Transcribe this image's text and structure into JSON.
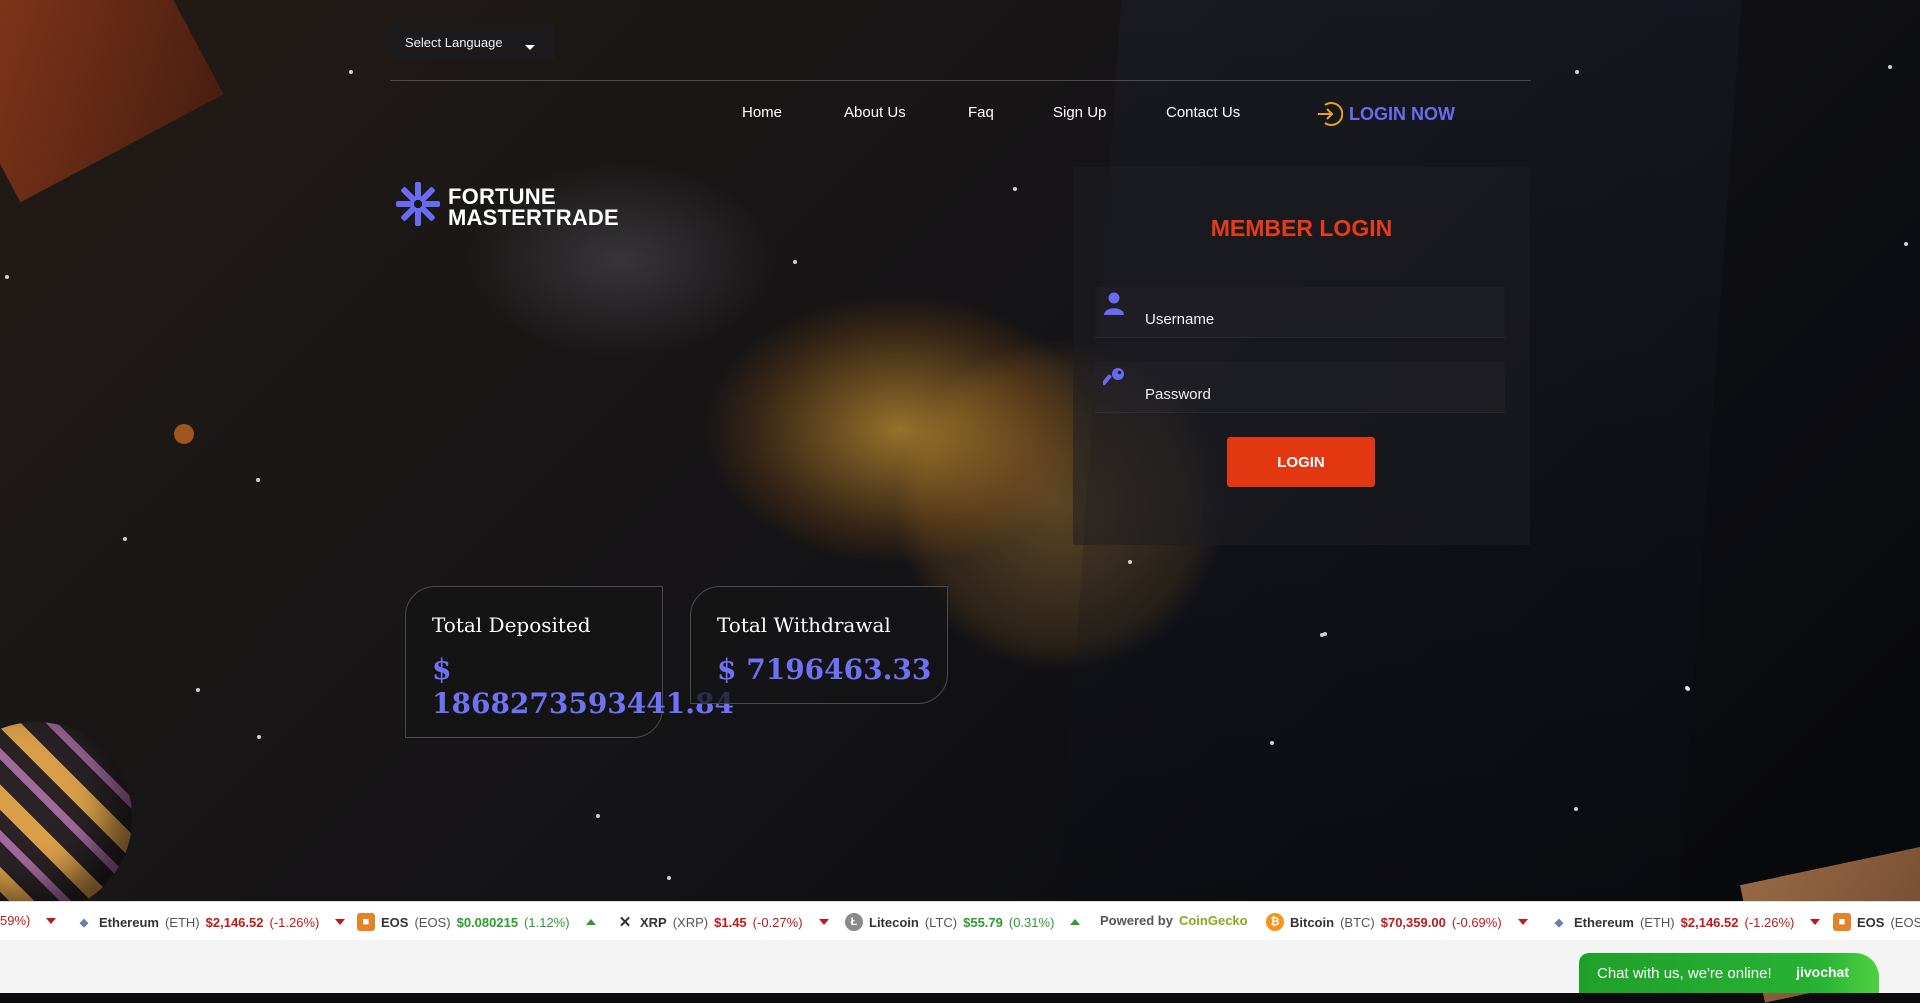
{
  "header": {
    "language_select": "Select Language",
    "nav": [
      {
        "label": "Home"
      },
      {
        "label": "About Us"
      },
      {
        "label": "Faq"
      },
      {
        "label": "Sign Up"
      },
      {
        "label": "Contact Us"
      }
    ],
    "login_now": "LOGIN NOW"
  },
  "logo": {
    "line1": "FORTUNE",
    "line2": "MASTERTRADE"
  },
  "login": {
    "title": "MEMBER LOGIN",
    "username_label": "Username",
    "password_label": "Password",
    "button": "LOGIN"
  },
  "stats": {
    "deposited_title": "Total Deposited",
    "deposited_value_prefix": "$",
    "deposited_value": "1868273593441.84",
    "withdrawal_title": "Total Withdrawal",
    "withdrawal_value": "$ 7196463.33"
  },
  "ticker": {
    "leading_fragment": "59%)",
    "items": [
      {
        "name": "Ethereum",
        "symbol": "(ETH)",
        "price": "$2,146.52",
        "change": "(-1.26%)",
        "direction": "down",
        "icon": "ethereum-icon"
      },
      {
        "name": "EOS",
        "symbol": "(EOS)",
        "price": "$0.080215",
        "change": "(1.12%)",
        "direction": "up",
        "icon": "eos-icon"
      },
      {
        "name": "XRP",
        "symbol": "(XRP)",
        "price": "$1.45",
        "change": "(-0.27%)",
        "direction": "down",
        "icon": "xrp-icon"
      },
      {
        "name": "Litecoin",
        "symbol": "(LTC)",
        "price": "$55.79",
        "change": "(0.31%)",
        "direction": "up",
        "icon": "litecoin-icon"
      },
      {
        "name": "Bitcoin",
        "symbol": "(BTC)",
        "price": "$70,359.00",
        "change": "(-0.69%)",
        "direction": "down",
        "icon": "bitcoin-icon"
      },
      {
        "name": "Ethereum",
        "symbol": "(ETH)",
        "price": "$2,146.52",
        "change": "(-1.26%)",
        "direction": "down",
        "icon": "ethereum-icon"
      },
      {
        "name": "EOS",
        "symbol": "(EOS)",
        "price": "",
        "change": "",
        "direction": "up",
        "icon": "eos-icon"
      }
    ],
    "powered_by": "Powered by",
    "powered_brand": "CoinGecko"
  },
  "chat": {
    "message": "Chat with us, we're online!",
    "brand": "jivochat"
  },
  "colors": {
    "accent_blue": "#6a6cf0",
    "accent_red": "#e23710",
    "up_green": "#2e9b2e",
    "down_red": "#c0191a",
    "chat_green": "#27b233"
  }
}
